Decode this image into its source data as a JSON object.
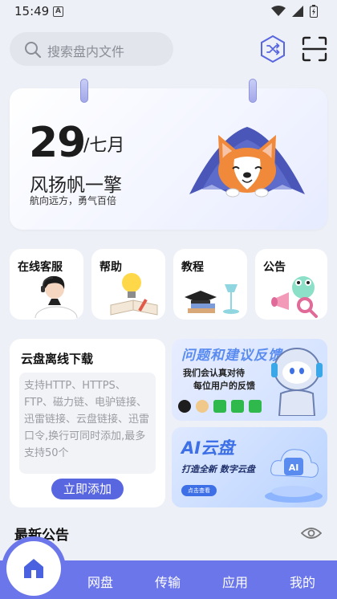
{
  "status_bar": {
    "time": "15:49",
    "a_badge": "A"
  },
  "search": {
    "placeholder": "搜索盘内文件"
  },
  "calendar": {
    "day": "29",
    "month": "/七月",
    "title": "风扬帆一擎",
    "subtitle": "航向远方，勇气百倍"
  },
  "quick": [
    {
      "label": "在线客服",
      "icon": "headset-agent-icon"
    },
    {
      "label": "帮助",
      "icon": "lightbulb-book-icon"
    },
    {
      "label": "教程",
      "icon": "graduation-cap-icon"
    },
    {
      "label": "公告",
      "icon": "megaphone-icon"
    }
  ],
  "offline": {
    "title": "云盘离线下载",
    "description": "支持HTTP、HTTPS、FTP、磁力链、电驴链接、迅雷链接、云盘链接、迅雷口令,换行可同时添加,最多支持50个",
    "button": "立即添加"
  },
  "feedback": {
    "title": "问题和建议反馈",
    "line1": "我们会认真对待",
    "line2": "每位用户的反馈"
  },
  "ai": {
    "title": "AI云盘",
    "subtitle": "打造全新 数字云盘",
    "button": "点击查看"
  },
  "notice": {
    "title": "最新公告"
  },
  "nav": {
    "items": [
      "网盘",
      "传输",
      "应用",
      "我的"
    ]
  },
  "colors": {
    "accent": "#6b76ea",
    "button": "#5866e0"
  }
}
